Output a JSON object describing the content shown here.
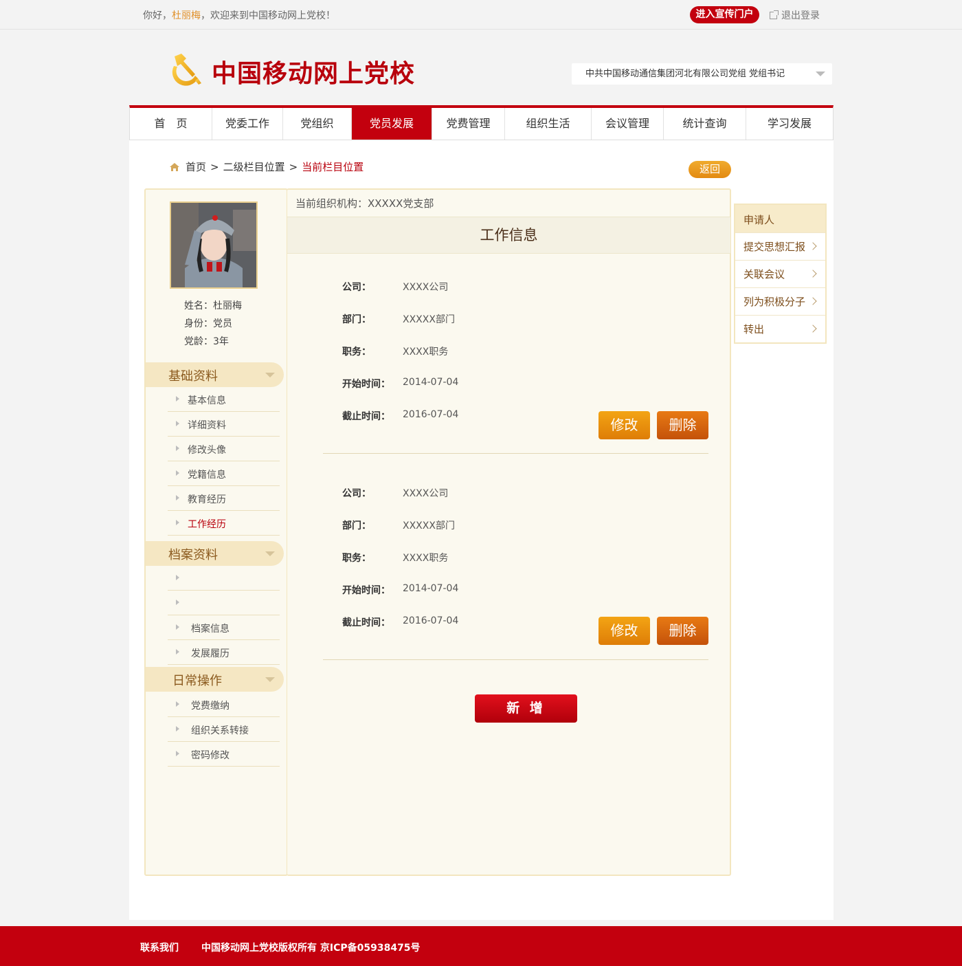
{
  "topbar": {
    "greet_prefix": "你好，",
    "username": "杜丽梅",
    "greet_suffix": "，欢迎来到中国移动网上党校！",
    "portal_button": "进入宣传门户",
    "logout_label": "退出登录"
  },
  "header": {
    "site_title": "中国移动网上党校",
    "org_select_value": "中共中国移动通信集团河北有限公司党组   党组书记"
  },
  "nav": {
    "items": [
      {
        "label": "首　页",
        "active": false
      },
      {
        "label": "党委工作",
        "active": false
      },
      {
        "label": "党组织",
        "active": false
      },
      {
        "label": "党员发展",
        "active": true
      },
      {
        "label": "党费管理",
        "active": false
      },
      {
        "label": "组织生活",
        "active": false
      },
      {
        "label": "会议管理",
        "active": false
      },
      {
        "label": "统计查询",
        "active": false
      },
      {
        "label": "学习发展",
        "active": false
      }
    ]
  },
  "breadcrumb": {
    "home": "首页",
    "sep": ">",
    "level2": "二级栏目位置",
    "current": "当前栏目位置",
    "back_button": "返回"
  },
  "profile": {
    "name_line": "姓名：杜丽梅",
    "role_line": "身份：党员",
    "age_line": "党龄：3年"
  },
  "sidebar": {
    "sections": [
      {
        "title": "基础资料",
        "items": [
          "基本信息",
          "详细资料",
          "修改头像",
          "党籍信息",
          "教育经历",
          "工作经历"
        ]
      },
      {
        "title": "档案资料",
        "items": [
          "",
          "",
          "档案信息",
          "发展履历"
        ]
      },
      {
        "title": "日常操作",
        "items": [
          "党费缴纳",
          "组织关系转接",
          "密码修改"
        ]
      }
    ],
    "active_item": "工作经历"
  },
  "main": {
    "org_line": "当前组织机构：XXXXX党支部",
    "heading": "工作信息",
    "field_labels": {
      "company": "公司：",
      "department": "部门：",
      "position": "职务：",
      "start": "开始时间：",
      "end": "截止时间："
    },
    "records": [
      {
        "company": "XXXX公司",
        "department": "XXXXX部门",
        "position": "XXXX职务",
        "start": "2014-07-04",
        "end": "2016-07-04"
      },
      {
        "company": "XXXX公司",
        "department": "XXXXX部门",
        "position": "XXXX职务",
        "start": "2014-07-04",
        "end": "2016-07-04"
      }
    ],
    "edit_button": "修改",
    "delete_button": "删除",
    "add_button": "新 增"
  },
  "right_menu": {
    "title": "申请人",
    "items": [
      "提交思想汇报",
      "关联会议",
      "列为积极分子",
      "转出"
    ]
  },
  "footer": {
    "contact": "联系我们",
    "copyright": "中国移动网上党校版权所有  京ICP备05938475号"
  },
  "colors": {
    "brand_red": "#c3000e",
    "accent_orange": "#e38a11",
    "panel_bg": "#fbf9ef"
  }
}
